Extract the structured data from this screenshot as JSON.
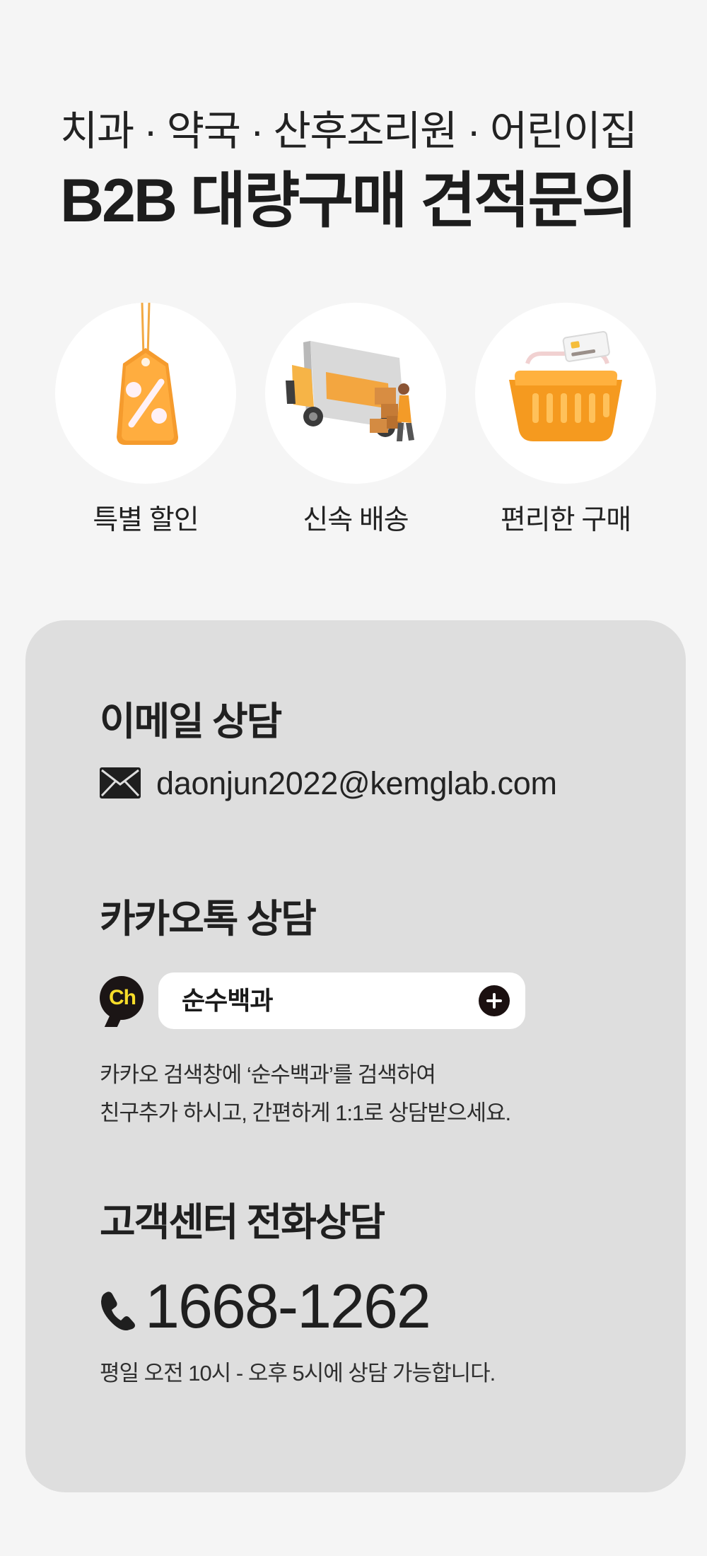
{
  "header": {
    "subtitle": "치과 · 약국 · 산후조리원 · 어린이집",
    "title": "B2B 대량구매 견적문의"
  },
  "features": [
    {
      "label": "특별 할인",
      "icon": "discount-tag-icon"
    },
    {
      "label": "신속 배송",
      "icon": "delivery-truck-icon"
    },
    {
      "label": "편리한 구매",
      "icon": "shopping-basket-icon"
    }
  ],
  "consultation": {
    "email": {
      "title": "이메일 상담",
      "icon": "mail-icon",
      "address": "daonjun2022@kemglab.com"
    },
    "kakao": {
      "title": "카카오톡 상담",
      "badge": "Ch",
      "search_text": "순수백과",
      "icon": "plus-icon",
      "description": [
        "카카오 검색창에 ‘순수백과’를 검색하여",
        "친구추가 하시고, 간편하게 1:1로 상담받으세요."
      ]
    },
    "phone": {
      "title": "고객센터 전화상담",
      "icon": "phone-icon",
      "number": "1668-1262",
      "hours": "평일 오전 10시 - 오후 5시에 상담 가능합니다."
    }
  },
  "colors": {
    "background": "#f5f5f5",
    "panel": "#dedede",
    "accent": "#f39a2a",
    "kakao_yellow": "#f7dd2a",
    "text": "#1f1f1f"
  }
}
